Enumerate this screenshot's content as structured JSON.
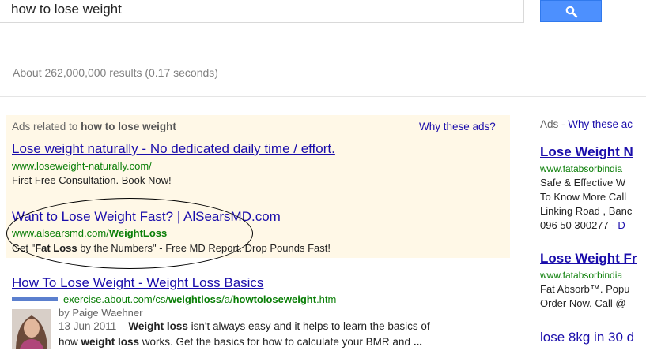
{
  "search": {
    "query": "how to lose weight"
  },
  "stats": {
    "text": "About 262,000,000 results (0.17 seconds)"
  },
  "top_ads": {
    "heading_prefix": "Ads related to ",
    "heading_query": "how to lose weight",
    "why_label": "Why these ads?",
    "items": [
      {
        "title": "Lose weight naturally - No dedicated daily time / effort.",
        "url": "www.loseweight-naturally.com/",
        "desc": "First Free Consultation. Book Now!"
      },
      {
        "title": "Want to Lose Weight Fast? | AlSearsMD.com",
        "url_prefix": "www.alsearsmd.com/",
        "url_bold": "WeightLoss",
        "desc_pre": "Get \"",
        "desc_bold": "Fat Loss",
        "desc_post": " by the Numbers\" - Free MD Report. Drop Pounds Fast!"
      }
    ]
  },
  "organic": {
    "title": "How To Lose Weight - Weight Loss Basics",
    "url_pre": "exercise.about.com/cs/",
    "url_bold": "weightloss",
    "url_mid": "/a/",
    "url_bold2": "howtoloseweight",
    "url_post": ".htm",
    "author": "by Paige Waehner",
    "date": "13 Jun 2011",
    "sep": " – ",
    "snippet1_bold": "Weight loss",
    "snippet1_rest": " isn't always easy and it helps to learn the basics of",
    "snippet2_pre": "how ",
    "snippet2_bold": "weight loss",
    "snippet2_rest": " works. Get the basics for how to calculate your BMR and ",
    "snippet2_ellipsis": "..."
  },
  "right_ads": {
    "heading": "Ads - ",
    "why": "Why these ac",
    "items": [
      {
        "title": "Lose Weight N",
        "url": "www.fatabsorbindia",
        "lines": [
          "Safe & Effective W",
          "To Know More Call",
          "Linking Road , Banc"
        ],
        "last_pre": "096 50 300277 - ",
        "last_link": "D"
      },
      {
        "title": "Lose Weight Fr",
        "url": "www.fatabsorbindia",
        "lines": [
          "Fat Absorb™. Popu",
          "Order Now. Call @"
        ]
      },
      {
        "title": "lose 8kg in 30 d"
      }
    ]
  }
}
